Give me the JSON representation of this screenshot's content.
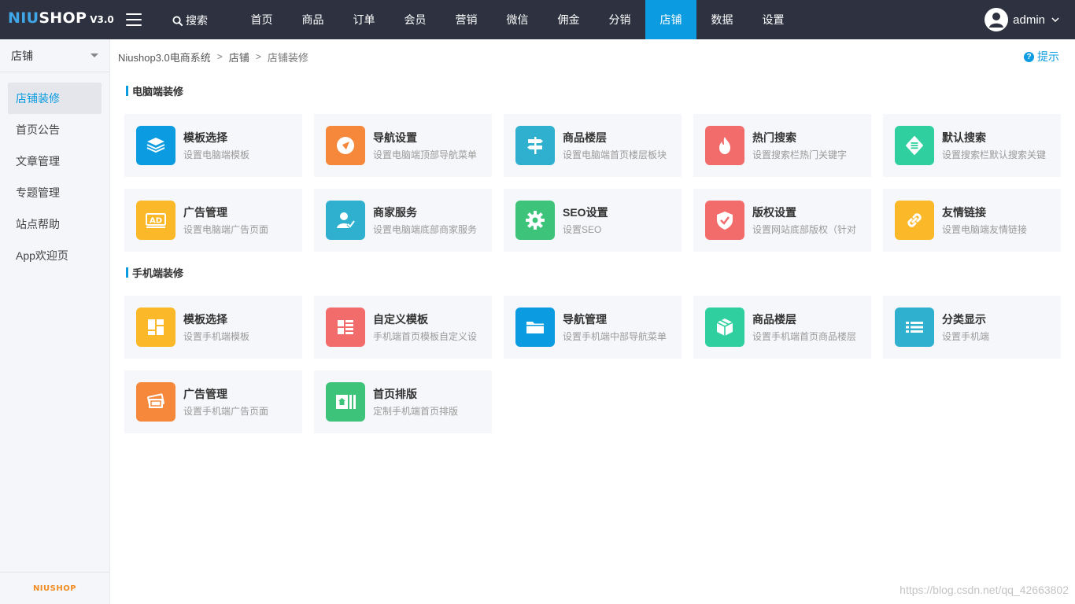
{
  "colors": {
    "topbar": "#2e3240",
    "accent": "#0a9be0"
  },
  "logo": {
    "brand_a": "NIU",
    "brand_b": "SHOP",
    "version": "V3.0"
  },
  "search": {
    "label": "搜索"
  },
  "nav": {
    "items": [
      {
        "label": "首页"
      },
      {
        "label": "商品"
      },
      {
        "label": "订单"
      },
      {
        "label": "会员"
      },
      {
        "label": "营销"
      },
      {
        "label": "微信"
      },
      {
        "label": "佣金"
      },
      {
        "label": "分销"
      },
      {
        "label": "店铺"
      },
      {
        "label": "数据"
      },
      {
        "label": "设置"
      }
    ],
    "active": "店铺"
  },
  "user": {
    "name": "admin"
  },
  "sidebar": {
    "header": "店铺",
    "items": [
      {
        "label": "店铺装修"
      },
      {
        "label": "首页公告"
      },
      {
        "label": "文章管理"
      },
      {
        "label": "专题管理"
      },
      {
        "label": "站点帮助"
      },
      {
        "label": "App欢迎页"
      }
    ],
    "active": "店铺装修",
    "footer_logo": "NIUSHOP"
  },
  "breadcrumb": {
    "items": [
      "Niushop3.0电商系统",
      "店铺",
      "店铺装修"
    ],
    "separator": ">"
  },
  "tip": {
    "label": "提示"
  },
  "pc": {
    "title": "电脑端装修",
    "cards": [
      {
        "title": "模板选择",
        "desc": "设置电脑端模板",
        "icon": "layers-icon",
        "color": "#0a9be0"
      },
      {
        "title": "导航设置",
        "desc": "设置电脑端顶部导航菜单",
        "icon": "navigation-arrow-icon",
        "color": "#f5883a"
      },
      {
        "title": "商品楼层",
        "desc": "设置电脑端首页楼层板块",
        "icon": "signpost-icon",
        "color": "#2fb0cf"
      },
      {
        "title": "热门搜索",
        "desc": "设置搜索栏热门关键字",
        "icon": "fire-icon",
        "color": "#f36c6c"
      },
      {
        "title": "默认搜索",
        "desc": "设置搜索栏默认搜索关键",
        "icon": "list-badge-icon",
        "color": "#2fcf9f"
      },
      {
        "title": "广告管理",
        "desc": "设置电脑端广告页面",
        "icon": "ad-icon",
        "color": "#fbb92a"
      },
      {
        "title": "商家服务",
        "desc": "设置电脑端底部商家服务",
        "icon": "user-service-icon",
        "color": "#2fb0cf"
      },
      {
        "title": "SEO设置",
        "desc": "设置SEO",
        "icon": "gear-icon",
        "color": "#3ec47a"
      },
      {
        "title": "版权设置",
        "desc": "设置网站底部版权（针对",
        "icon": "shield-check-icon",
        "color": "#f36c6c"
      },
      {
        "title": "友情链接",
        "desc": "设置电脑端友情链接",
        "icon": "link-icon",
        "color": "#fbb92a"
      }
    ]
  },
  "mobile": {
    "title": "手机端装修",
    "cards": [
      {
        "title": "模板选择",
        "desc": "设置手机端模板",
        "icon": "dashboard-icon",
        "color": "#fbb92a"
      },
      {
        "title": "自定义模板",
        "desc": "手机端首页模板自定义设",
        "icon": "list-layout-icon",
        "color": "#f36c6c"
      },
      {
        "title": "导航管理",
        "desc": "设置手机端中部导航菜单",
        "icon": "folder-icon",
        "color": "#0a9be0"
      },
      {
        "title": "商品楼层",
        "desc": "设置手机端首页商品楼层",
        "icon": "box-icon",
        "color": "#2fcf9f"
      },
      {
        "title": "分类显示",
        "desc": "设置手机端",
        "icon": "list-icon",
        "color": "#2fb0cf"
      },
      {
        "title": "广告管理",
        "desc": "设置手机端广告页面",
        "icon": "ad-cards-icon",
        "color": "#f5883a"
      },
      {
        "title": "首页排版",
        "desc": "定制手机端首页排版",
        "icon": "home-layout-icon",
        "color": "#3ec47a"
      }
    ]
  },
  "watermark": "https://blog.csdn.net/qq_42663802"
}
